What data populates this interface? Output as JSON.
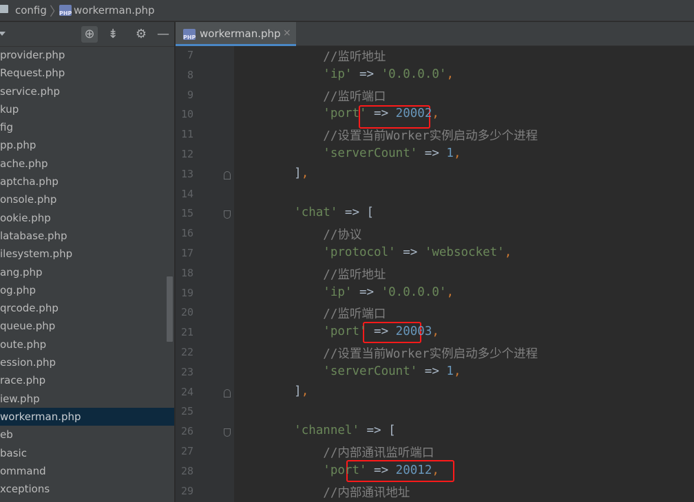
{
  "breadcrumb": {
    "folder": "config",
    "file": "workerman.php"
  },
  "project_panel": {
    "files": [
      "provider.php",
      "Request.php",
      "service.php",
      "kup",
      "fig",
      "pp.php",
      "ache.php",
      "aptcha.php",
      "onsole.php",
      "ookie.php",
      "latabase.php",
      "ilesystem.php",
      "ang.php",
      "og.php",
      "qrcode.php",
      "queue.php",
      "oute.php",
      "ession.php",
      "race.php",
      "iew.php",
      "workerman.php",
      "eb",
      "basic",
      "ommand",
      "xceptions"
    ],
    "selected_index": 20
  },
  "tab": {
    "label": "workerman.php",
    "close": "×"
  },
  "editor": {
    "lines": [
      {
        "n": "7",
        "t": [
          [
            "cmt",
            "        //监听地址"
          ]
        ]
      },
      {
        "n": "8",
        "t": [
          [
            "op",
            "        "
          ],
          [
            "str",
            "'ip'"
          ],
          [
            "op",
            " => "
          ],
          [
            "str",
            "'0.0.0.0'"
          ],
          [
            "pun",
            ","
          ]
        ]
      },
      {
        "n": "9",
        "t": [
          [
            "cmt",
            "        //监听端口"
          ]
        ]
      },
      {
        "n": "10",
        "t": [
          [
            "op",
            "        "
          ],
          [
            "str",
            "'port'"
          ],
          [
            "op",
            " => "
          ],
          [
            "num",
            "20002"
          ],
          [
            "pun",
            ","
          ]
        ]
      },
      {
        "n": "11",
        "t": [
          [
            "cmt",
            "        //设置当前Worker实例启动多少个进程"
          ]
        ]
      },
      {
        "n": "12",
        "t": [
          [
            "op",
            "        "
          ],
          [
            "str",
            "'serverCount'"
          ],
          [
            "op",
            " => "
          ],
          [
            "num",
            "1"
          ],
          [
            "pun",
            ","
          ]
        ]
      },
      {
        "n": "13",
        "t": [
          [
            "op",
            "    ]"
          ],
          [
            "pun",
            ","
          ]
        ],
        "fold": "close"
      },
      {
        "n": "14",
        "t": []
      },
      {
        "n": "15",
        "t": [
          [
            "op",
            "    "
          ],
          [
            "str",
            "'chat'"
          ],
          [
            "op",
            " => ["
          ]
        ],
        "fold": "open"
      },
      {
        "n": "16",
        "t": [
          [
            "cmt",
            "        //协议"
          ]
        ]
      },
      {
        "n": "17",
        "t": [
          [
            "op",
            "        "
          ],
          [
            "str",
            "'protocol'"
          ],
          [
            "op",
            " => "
          ],
          [
            "str",
            "'websocket'"
          ],
          [
            "pun",
            ","
          ]
        ]
      },
      {
        "n": "18",
        "t": [
          [
            "cmt",
            "        //监听地址"
          ]
        ]
      },
      {
        "n": "19",
        "t": [
          [
            "op",
            "        "
          ],
          [
            "str",
            "'ip'"
          ],
          [
            "op",
            " => "
          ],
          [
            "str",
            "'0.0.0.0'"
          ],
          [
            "pun",
            ","
          ]
        ]
      },
      {
        "n": "20",
        "t": [
          [
            "cmt",
            "        //监听端口"
          ]
        ]
      },
      {
        "n": "21",
        "t": [
          [
            "op",
            "        "
          ],
          [
            "str",
            "'port'"
          ],
          [
            "op",
            " => "
          ],
          [
            "num",
            "20003"
          ],
          [
            "pun",
            ","
          ]
        ]
      },
      {
        "n": "22",
        "t": [
          [
            "cmt",
            "        //设置当前Worker实例启动多少个进程"
          ]
        ]
      },
      {
        "n": "23",
        "t": [
          [
            "op",
            "        "
          ],
          [
            "str",
            "'serverCount'"
          ],
          [
            "op",
            " => "
          ],
          [
            "num",
            "1"
          ],
          [
            "pun",
            ","
          ]
        ]
      },
      {
        "n": "24",
        "t": [
          [
            "op",
            "    ]"
          ],
          [
            "pun",
            ","
          ]
        ],
        "fold": "close"
      },
      {
        "n": "25",
        "t": []
      },
      {
        "n": "26",
        "t": [
          [
            "op",
            "    "
          ],
          [
            "str",
            "'channel'"
          ],
          [
            "op",
            " => ["
          ]
        ],
        "fold": "open"
      },
      {
        "n": "27",
        "t": [
          [
            "cmt",
            "        //内部通讯监听端口"
          ]
        ]
      },
      {
        "n": "28",
        "t": [
          [
            "op",
            "        "
          ],
          [
            "str",
            "'port'"
          ],
          [
            "op",
            " => "
          ],
          [
            "num",
            "20012"
          ],
          [
            "pun",
            ","
          ]
        ]
      },
      {
        "n": "29",
        "t": [
          [
            "cmt",
            "        //内部通讯地址"
          ]
        ]
      }
    ]
  },
  "highlight_color": "#ff1a1a"
}
